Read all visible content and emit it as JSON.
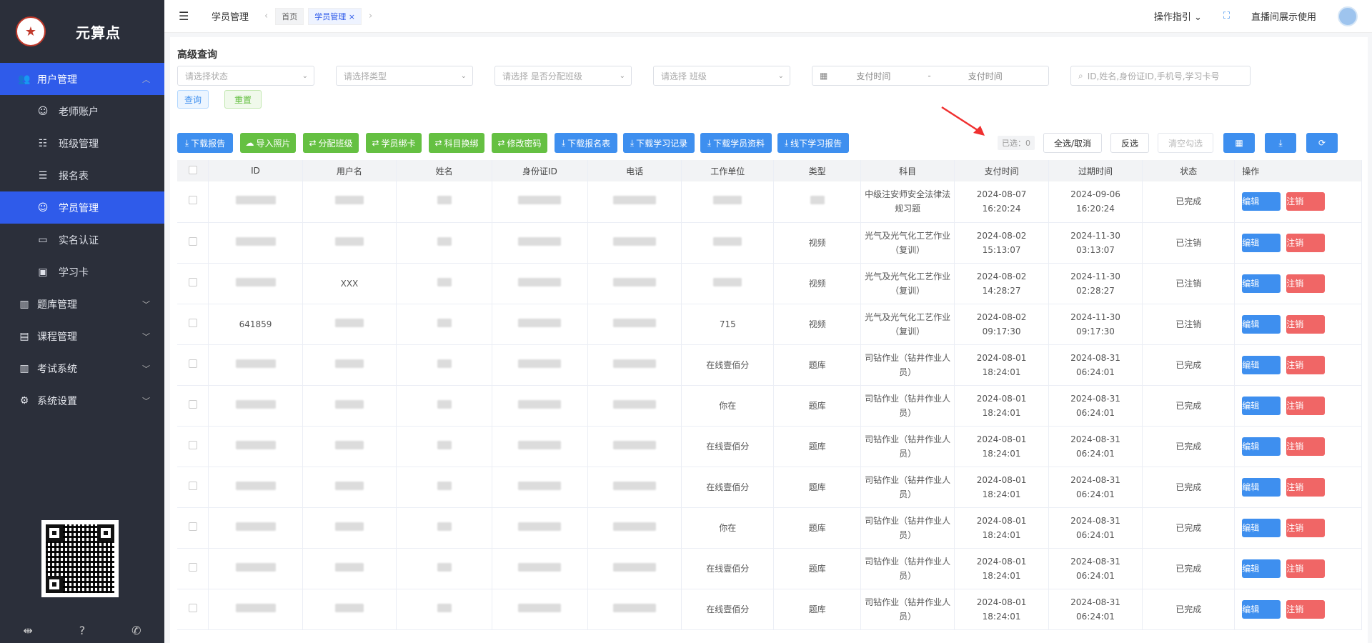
{
  "app": {
    "logo_text": "元算点"
  },
  "sidebar": {
    "items": [
      {
        "label": "用户管理",
        "icon": "users-icon",
        "expanded": true
      },
      {
        "label": "题库管理",
        "icon": "library-icon"
      },
      {
        "label": "课程管理",
        "icon": "book-icon"
      },
      {
        "label": "考试系统",
        "icon": "exam-icon"
      },
      {
        "label": "系统设置",
        "icon": "gear-icon"
      }
    ],
    "sub_items": [
      {
        "label": "老师账户",
        "icon": "user-icon"
      },
      {
        "label": "班级管理",
        "icon": "group-icon"
      },
      {
        "label": "报名表",
        "icon": "user-list-icon"
      },
      {
        "label": "学员管理",
        "icon": "user-icon",
        "active": true
      },
      {
        "label": "实名认证",
        "icon": "id-card-icon"
      },
      {
        "label": "学习卡",
        "icon": "card-icon"
      }
    ]
  },
  "topbar": {
    "breadcrumb": "学员管理",
    "tabs": [
      "首页",
      "学员管理"
    ],
    "guide": "操作指引",
    "user": "直播间展示使用"
  },
  "filters": {
    "title": "高级查询",
    "status_placeholder": "请选择状态",
    "type_placeholder": "请选择类型",
    "class_assigned_placeholder": "请选择 是否分配班级",
    "class_placeholder": "请选择 班级",
    "pay_time_start": "支付时间",
    "range_sep": "-",
    "pay_time_end": "支付时间",
    "search_placeholder": "ID,姓名,身份证ID,手机号,学习卡号",
    "query_button": "查询",
    "reset_button": "重置"
  },
  "toolbar": {
    "buttons": [
      {
        "label": "下载报告",
        "icon": "download-icon"
      },
      {
        "label": "导入照片",
        "icon": "upload-icon"
      },
      {
        "label": "分配班级",
        "icon": "swap-icon"
      },
      {
        "label": "学员绑卡",
        "icon": "swap-icon"
      },
      {
        "label": "科目换绑",
        "icon": "swap-icon"
      },
      {
        "label": "修改密码",
        "icon": "swap-icon"
      },
      {
        "label": "下载报名表",
        "icon": "download-icon"
      },
      {
        "label": "下载学习记录",
        "icon": "download-icon"
      },
      {
        "label": "下载学员资料",
        "icon": "download-icon"
      },
      {
        "label": "线下学习报告",
        "icon": "download-icon"
      }
    ],
    "selected_count": "已选：0",
    "select_all": "全选/取消",
    "invert": "反选",
    "clear": "清空勾选"
  },
  "table": {
    "headers": [
      "ID",
      "用户名",
      "姓名",
      "身份证ID",
      "电话",
      "工作单位",
      "类型",
      "科目",
      "支付时间",
      "过期时间",
      "状态",
      "操作"
    ],
    "edit_label": "编辑",
    "cancel_label": "注销",
    "rows": [
      {
        "id": "",
        "username": "",
        "name": "",
        "idcard": "",
        "phone": "",
        "unit": "",
        "type": "",
        "subject": "中级注安师安全法律法规习题",
        "pay": "2024-08-07 16:20:24",
        "expire": "2024-09-06 16:20:24",
        "status": "已完成"
      },
      {
        "id": "",
        "username": "",
        "name": "",
        "idcard": "",
        "phone": "",
        "unit": "",
        "type": "视频",
        "subject": "光气及光气化工艺作业（复训）",
        "pay": "2024-08-02 15:13:07",
        "expire": "2024-11-30 03:13:07",
        "status": "已注销"
      },
      {
        "id": "",
        "username": "XXX",
        "name": "",
        "idcard": "",
        "phone": "",
        "unit": "",
        "type": "视频",
        "subject": "光气及光气化工艺作业（复训）",
        "pay": "2024-08-02 14:28:27",
        "expire": "2024-11-30 02:28:27",
        "status": "已注销"
      },
      {
        "id": "641859",
        "username": "",
        "name": "",
        "idcard": "",
        "phone": "",
        "unit": "715",
        "type": "视频",
        "subject": "光气及光气化工艺作业（复训）",
        "pay": "2024-08-02 09:17:30",
        "expire": "2024-11-30 09:17:30",
        "status": "已注销"
      },
      {
        "id": "",
        "username": "",
        "name": "",
        "idcard": "",
        "phone": "",
        "unit": "在线壹佰分",
        "type": "题库",
        "subject": "司钻作业（钻井作业人员）",
        "pay": "2024-08-01 18:24:01",
        "expire": "2024-08-31 06:24:01",
        "status": "已完成"
      },
      {
        "id": "",
        "username": "",
        "name": "",
        "idcard": "",
        "phone": "",
        "unit": "你在",
        "type": "题库",
        "subject": "司钻作业（钻井作业人员）",
        "pay": "2024-08-01 18:24:01",
        "expire": "2024-08-31 06:24:01",
        "status": "已完成"
      },
      {
        "id": "",
        "username": "",
        "name": "",
        "idcard": "",
        "phone": "",
        "unit": "在线壹佰分",
        "type": "题库",
        "subject": "司钻作业（钻井作业人员）",
        "pay": "2024-08-01 18:24:01",
        "expire": "2024-08-31 06:24:01",
        "status": "已完成"
      },
      {
        "id": "",
        "username": "",
        "name": "",
        "idcard": "",
        "phone": "",
        "unit": "在线壹佰分",
        "type": "题库",
        "subject": "司钻作业（钻井作业人员）",
        "pay": "2024-08-01 18:24:01",
        "expire": "2024-08-31 06:24:01",
        "status": "已完成"
      },
      {
        "id": "",
        "username": "",
        "name": "",
        "idcard": "",
        "phone": "",
        "unit": "你在",
        "type": "题库",
        "subject": "司钻作业（钻井作业人员）",
        "pay": "2024-08-01 18:24:01",
        "expire": "2024-08-31 06:24:01",
        "status": "已完成"
      },
      {
        "id": "",
        "username": "",
        "name": "",
        "idcard": "",
        "phone": "",
        "unit": "在线壹佰分",
        "type": "题库",
        "subject": "司钻作业（钻井作业人员）",
        "pay": "2024-08-01 18:24:01",
        "expire": "2024-08-31 06:24:01",
        "status": "已完成"
      },
      {
        "id": "",
        "username": "",
        "name": "",
        "idcard": "",
        "phone": "",
        "unit": "在线壹佰分",
        "type": "题库",
        "subject": "司钻作业（钻井作业人员）",
        "pay": "2024-08-01 18:24:01",
        "expire": "2024-08-31 06:24:01",
        "status": "已完成"
      }
    ]
  },
  "colors": {
    "primary": "#3e8fef",
    "success": "#65c042",
    "danger": "#f06666",
    "sidebar": "#2b2f3a",
    "active": "#2f5bea"
  }
}
